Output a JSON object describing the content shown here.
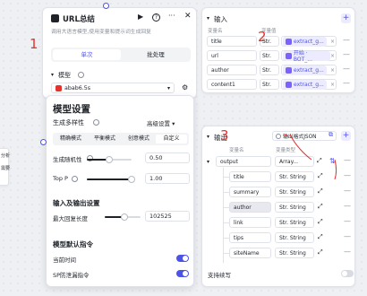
{
  "url_node": {
    "title": "URL总结",
    "description": "调用大语言模型,使用变量和提示词生成回复",
    "tabs": [
      "单次",
      "批处理"
    ],
    "model_section_label": "模型",
    "model_value": "abab6.5s"
  },
  "model_settings": {
    "title": "模型设置",
    "diversity_label": "生成多样性",
    "advanced_label": "高级设置",
    "modes": [
      "精确模式",
      "平衡模式",
      "创意模式",
      "自定义"
    ],
    "temperature_label": "生成随机性",
    "temperature_value": "0.50",
    "temperature_fraction": 0.5,
    "top_p_label": "Top P",
    "top_p_value": "1.00",
    "top_p_fraction": 1.0,
    "io_title": "输入及输出设置",
    "max_tokens_label": "最大回复长度",
    "max_tokens_value": "102525",
    "max_tokens_fraction": 0.55,
    "prompt_title": "模型默认指令",
    "current_time_label": "当前时间",
    "sp_label": "SP防泄漏指令"
  },
  "input_panel": {
    "title": "输入",
    "col_name": "变量名",
    "col_value": "变量值",
    "rows": [
      {
        "name": "title",
        "type": "Str.",
        "tag": "extract_g..."
      },
      {
        "name": "url",
        "type": "Str.",
        "tag": "开始 · BOT_..."
      },
      {
        "name": "author",
        "type": "Str.",
        "tag": "extract_g..."
      },
      {
        "name": "content1",
        "type": "Str.",
        "tag": "extract_g..."
      }
    ]
  },
  "output_panel": {
    "title": "输出",
    "format_label": "输出格式JSON",
    "col_name": "变量名",
    "col_type": "变量类型",
    "root": {
      "name": "output",
      "type": "Array..."
    },
    "children": [
      {
        "name": "title",
        "type": "Str. String"
      },
      {
        "name": "summary",
        "type": "Str. String"
      },
      {
        "name": "author",
        "type": "Str. String"
      },
      {
        "name": "link",
        "type": "Str. String"
      },
      {
        "name": "tips",
        "type": "Str. String"
      },
      {
        "name": "siteName",
        "type": "Str. String"
      }
    ],
    "footer_label": "支持续写"
  },
  "left_partial": {
    "line1": "分析",
    "line2": "需要拆分"
  },
  "annotations": [
    "1",
    "2",
    "3"
  ],
  "colors": {
    "accent": "#4d53e8",
    "annotation": "#e5322d",
    "tag_bg": "#ecebff"
  }
}
